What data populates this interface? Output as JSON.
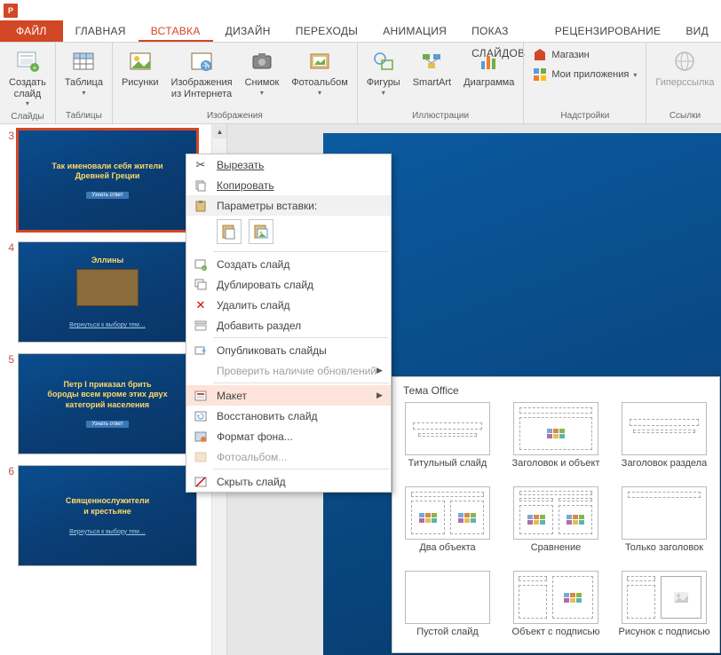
{
  "app_icon_text": "P",
  "tabs": {
    "file": "ФАЙЛ",
    "home": "ГЛАВНАЯ",
    "insert": "ВСТАВКА",
    "design": "ДИЗАЙН",
    "transitions": "ПЕРЕХОДЫ",
    "animation": "АНИМАЦИЯ",
    "slideshow": "ПОКАЗ СЛАЙДОВ",
    "review": "РЕЦЕНЗИРОВАНИЕ",
    "view": "ВИД"
  },
  "ribbon": {
    "groups": {
      "slides": {
        "label": "Слайды",
        "new_slide": "Создать\nслайд"
      },
      "tables": {
        "label": "Таблицы",
        "table": "Таблица"
      },
      "images": {
        "label": "Изображения",
        "pictures": "Рисунки",
        "online_pictures": "Изображения\nиз Интернета",
        "screenshot": "Снимок",
        "photo_album": "Фотоальбом"
      },
      "illustrations": {
        "label": "Иллюстрации",
        "shapes": "Фигуры",
        "smartart": "SmartArt",
        "chart": "Диаграмма"
      },
      "addins": {
        "label": "Надстройки",
        "store": "Магазин",
        "my_apps": "Мои приложения"
      },
      "links": {
        "label": "Ссылки",
        "hyperlink": "Гиперссылка"
      }
    }
  },
  "thumbs": [
    {
      "num": "3",
      "title": "Так именовали себя жители\nДревней Греции",
      "button": "Узнать ответ",
      "selected": true,
      "has_image": false,
      "sub": ""
    },
    {
      "num": "4",
      "title": "Эллины",
      "button": "",
      "selected": false,
      "has_image": true,
      "sub": "Вернуться к выбору тем…"
    },
    {
      "num": "5",
      "title": "Петр I приказал брить\nбороды всем кроме этих двух\nкатегорий населения",
      "button": "Узнать ответ",
      "selected": false,
      "has_image": false,
      "sub": ""
    },
    {
      "num": "6",
      "title": "Священнослужители\nи крестьяне",
      "button": "",
      "selected": false,
      "has_image": false,
      "sub": "Вернуться к выбору тем…"
    }
  ],
  "context_menu": {
    "cut": "Вырезать",
    "copy": "Копировать",
    "paste_options_header": "Параметры вставки:",
    "new_slide": "Создать слайд",
    "duplicate_slide": "Дублировать слайд",
    "delete_slide": "Удалить слайд",
    "add_section": "Добавить раздел",
    "publish_slides": "Опубликовать слайды",
    "check_updates": "Проверить наличие обновлений",
    "layout": "Макет",
    "reset_slide": "Восстановить слайд",
    "format_background": "Формат фона...",
    "photo_album": "Фотоальбом...",
    "hide_slide": "Скрыть слайд"
  },
  "layout_gallery": {
    "title": "Тема Office",
    "items": [
      "Титульный слайд",
      "Заголовок и объект",
      "Заголовок раздела",
      "Два объекта",
      "Сравнение",
      "Только заголовок",
      "Пустой слайд",
      "Объект с подписью",
      "Рисунок с подписью"
    ]
  }
}
